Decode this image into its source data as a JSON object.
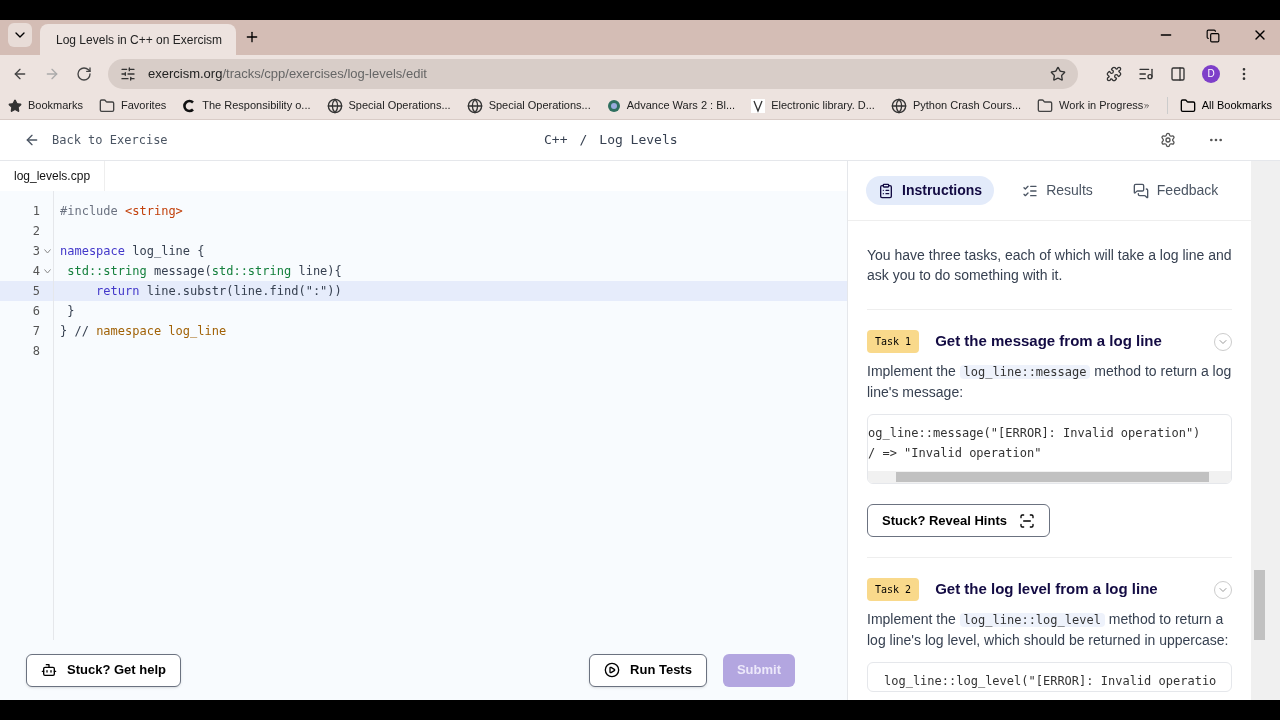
{
  "browser": {
    "tab_title": "Log Levels in C++ on Exercism",
    "url_host": "exercism.org",
    "url_path": "/tracks/cpp/exercises/log-levels/edit",
    "profile_initial": "D",
    "bookmarks": [
      {
        "label": "Bookmarks",
        "kind": "star"
      },
      {
        "label": "Favorites",
        "kind": "folder"
      },
      {
        "label": "The Responsibility o...",
        "kind": "letter"
      },
      {
        "label": "Special Operations...",
        "kind": "globe"
      },
      {
        "label": "Special Operations...",
        "kind": "globe"
      },
      {
        "label": "Advance Wars 2 : Bl...",
        "kind": "game"
      },
      {
        "label": "Electronic library. D...",
        "kind": "lib"
      },
      {
        "label": "Python Crash Cours...",
        "kind": "globe"
      },
      {
        "label": "Work in Progress",
        "kind": "folder"
      }
    ],
    "all_bookmarks": "All Bookmarks"
  },
  "header": {
    "back": "Back to Exercise",
    "track": "C++",
    "separator": "/",
    "exercise": "Log Levels"
  },
  "editor": {
    "file_tab": "log_levels.cpp",
    "lines": [
      {
        "number": "1",
        "foldable": false,
        "selected": false,
        "tokens": [
          {
            "text": "#include ",
            "kind": "meta"
          },
          {
            "text": "<string>",
            "kind": "string"
          }
        ]
      },
      {
        "number": "2",
        "foldable": false,
        "selected": false
      },
      {
        "number": "3",
        "foldable": true,
        "selected": false,
        "tokens": [
          {
            "text": "namespace",
            "kind": "keyword"
          },
          {
            "text": " log_line {",
            "kind": "plain"
          }
        ]
      },
      {
        "number": "4",
        "foldable": true,
        "selected": false,
        "tokens": [
          {
            "text": " std::string",
            "kind": "type"
          },
          {
            "text": " message(",
            "kind": "plain"
          },
          {
            "text": "std::string",
            "kind": "type"
          },
          {
            "text": " line){",
            "kind": "plain"
          }
        ]
      },
      {
        "number": "5",
        "foldable": false,
        "selected": true,
        "tokens": [
          {
            "text": "     return",
            "kind": "keyword"
          },
          {
            "text": " line.substr(line.find(\":\"))",
            "kind": "plain"
          }
        ]
      },
      {
        "number": "6",
        "foldable": false,
        "selected": false,
        "tokens": [
          {
            "text": " }",
            "kind": "plain"
          }
        ]
      },
      {
        "number": "7",
        "foldable": false,
        "selected": false,
        "tokens": [
          {
            "text": "} // ",
            "kind": "plain"
          },
          {
            "text": "namespace log_line",
            "kind": "comment"
          }
        ]
      },
      {
        "number": "8",
        "foldable": false,
        "selected": false
      }
    ]
  },
  "footer": {
    "help": "Stuck? Get help",
    "run": "Run Tests",
    "submit": "Submit",
    "submit_disabled": true
  },
  "panel": {
    "tabs": [
      {
        "label": "Instructions",
        "kind": "instructions",
        "selected": true
      },
      {
        "label": "Results",
        "kind": "results",
        "selected": false
      },
      {
        "label": "Feedback",
        "kind": "feedback",
        "selected": false
      }
    ],
    "intro": "You have three tasks, each of which will take a log line and ask you to do something with it.",
    "tasks": [
      {
        "badge": "Task 1",
        "title": "Get the message from a log line",
        "body": [
          {
            "text": "Implement the ",
            "kind": "text"
          },
          {
            "text": "log_line::message",
            "kind": "code"
          },
          {
            "text": " method to return a log line's message:",
            "kind": "text"
          }
        ],
        "code": [
          "og_line::message(\"[ERROR]: Invalid operation\")",
          "/ => \"Invalid operation\""
        ],
        "hint": "Stuck? Reveal Hints"
      },
      {
        "badge": "Task 2",
        "title": "Get the log level from a log line",
        "body": [
          {
            "text": "Implement the ",
            "kind": "text"
          },
          {
            "text": "log_line::log_level",
            "kind": "code"
          },
          {
            "text": " method to return a log line's log level, which should be returned in uppercase:",
            "kind": "text"
          }
        ],
        "code": [
          "log_line::log_level(\"[ERROR]: Invalid operatio"
        ]
      }
    ]
  }
}
